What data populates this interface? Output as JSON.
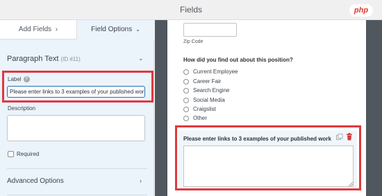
{
  "header": {
    "title": "Fields"
  },
  "watermark": {
    "text": "php"
  },
  "sidebar": {
    "tabs": [
      {
        "label": "Add Fields",
        "icon": "chevron-right-icon"
      },
      {
        "label": "Field Options",
        "icon": "chevron-down-icon"
      }
    ],
    "section_title": "Paragraph Text",
    "section_id": "(ID #11)",
    "label_field": {
      "label": "Label",
      "value": "Please enter links to 3 examples of your published work"
    },
    "description_label": "Description",
    "required_label": "Required",
    "advanced_label": "Advanced Options"
  },
  "form": {
    "zip_label": "Zip Code",
    "question": "How did you find out about this position?",
    "options": [
      "Current Employee",
      "Career Fair",
      "Search Engine",
      "Social Media",
      "Craigslist",
      "Other"
    ],
    "selected_field_label": "Please enter links to 3 examples of your published work"
  },
  "colors": {
    "highlight": "#e0393e",
    "accent": "#2271b1",
    "sidebar_bg": "#ebf3fb"
  }
}
